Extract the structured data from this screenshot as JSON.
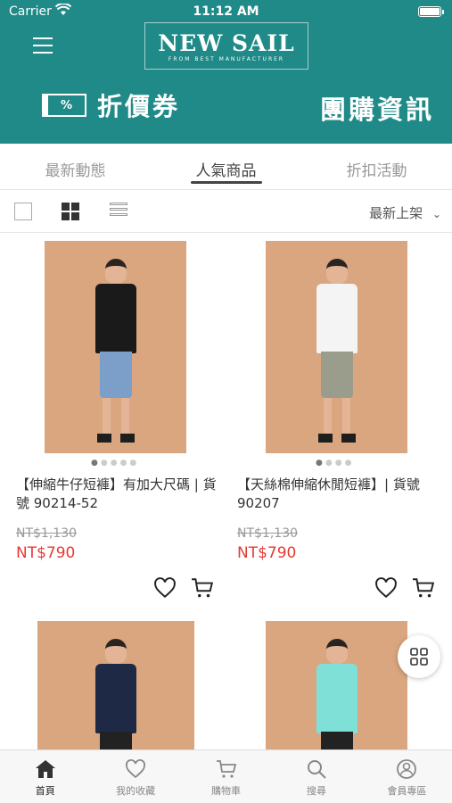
{
  "status_bar": {
    "carrier": "Carrier",
    "time": "11:12 AM"
  },
  "header": {
    "logo_name": "NEW SAIL",
    "logo_tagline": "FROM BEST MANUFACTURER",
    "coupon_label": "折價券",
    "coupon_icon_text": "%",
    "group_buy_label": "團購資訊",
    "brand_color": "#1f8a87"
  },
  "tabs": [
    {
      "label": "最新動態",
      "active": false
    },
    {
      "label": "人氣商品",
      "active": true
    },
    {
      "label": "折扣活動",
      "active": false
    }
  ],
  "toolbar": {
    "sort_label": "最新上架",
    "sort_arrow": "⌄"
  },
  "products": [
    {
      "title": "【伸縮牛仔短褲】有加大尺碼 | 貨號 90214-52",
      "old_price": "NT$1,130",
      "price": "NT$790",
      "top_color": "#1a1a1a",
      "bottom_color": "#7b9fc8"
    },
    {
      "title": "【天絲棉伸縮休閒短褲】| 貨號 90207",
      "old_price": "NT$1,130",
      "price": "NT$790",
      "top_color": "#f4f4f4",
      "bottom_color": "#9a9c8c"
    },
    {
      "title": "",
      "top_color": "#1e2a45",
      "bottom_color": "#222222"
    },
    {
      "title": "",
      "top_color": "#7fe0d8",
      "bottom_color": "#222222"
    }
  ],
  "image_dots": "●●●●●",
  "tabbar": [
    {
      "label": "首頁",
      "icon": "home-icon",
      "active": true
    },
    {
      "label": "我的收藏",
      "icon": "heart-icon",
      "active": false
    },
    {
      "label": "購物車",
      "icon": "cart-icon",
      "active": false
    },
    {
      "label": "搜尋",
      "icon": "search-icon",
      "active": false
    },
    {
      "label": "會員專區",
      "icon": "user-icon",
      "active": false
    }
  ],
  "colors": {
    "price": "#e53935",
    "accent": "#1f8a87"
  }
}
